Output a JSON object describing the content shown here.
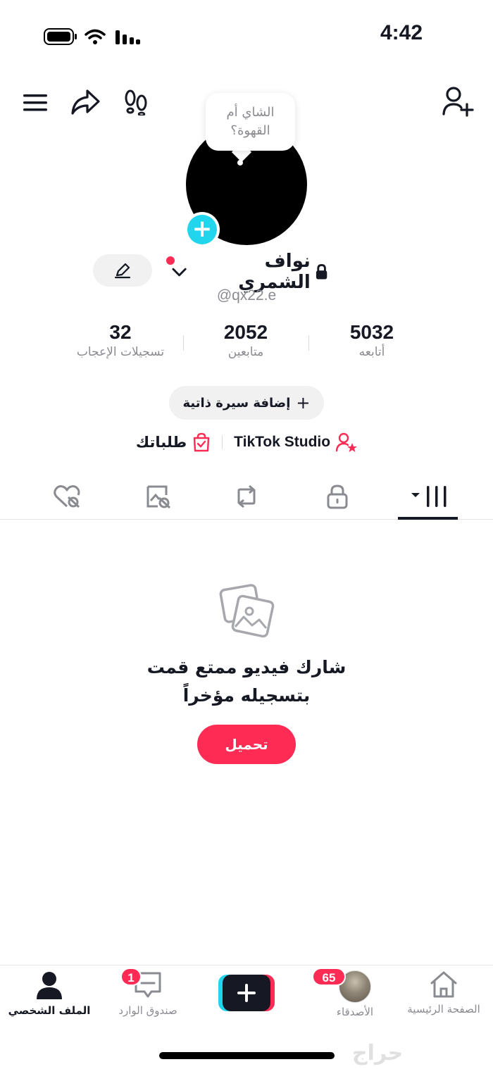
{
  "status_bar": {
    "time": "4:42"
  },
  "profile": {
    "bubble_text": "الشاي أم القهوة؟",
    "name": "نواف الشمري",
    "handle": "@qx22.e",
    "stats": [
      {
        "value": "5032",
        "label": "أتابعه"
      },
      {
        "value": "2052",
        "label": "متابعين"
      },
      {
        "value": "32",
        "label": "تسجيلات الإعجاب"
      }
    ],
    "add_bio_label": "إضافة سيرة ذاتية",
    "studio_label": "TikTok Studio",
    "orders_label": "طلباتك"
  },
  "empty_state": {
    "line1": "شارك فيديو ممتع قمت",
    "line2": "بتسجيله مؤخراً",
    "upload_label": "تحميل"
  },
  "bottom_nav": {
    "home": "الصفحة الرئيسية",
    "friends": "الأصدقاء",
    "friends_badge": "65",
    "inbox": "صندوق الوارد",
    "inbox_badge": "1",
    "profile": "الملف الشخصي"
  },
  "watermark": "حراج",
  "colors": {
    "accent": "#fe2c55",
    "cyan": "#20d5ec"
  }
}
